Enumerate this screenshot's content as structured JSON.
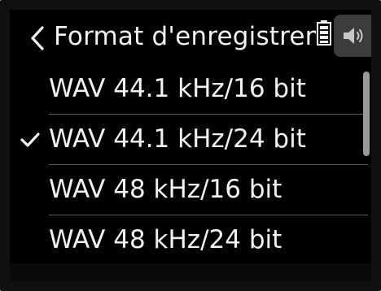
{
  "header": {
    "title": "Format d'enregistrem",
    "back_icon": "chevron-left-icon",
    "battery_icon": "battery-icon",
    "speaker_icon": "speaker-volume-icon"
  },
  "list": {
    "items": [
      {
        "label": "WAV 44.1 kHz/16 bit",
        "selected": false
      },
      {
        "label": "WAV 44.1 kHz/24 bit",
        "selected": true
      },
      {
        "label": "WAV 48 kHz/16 bit",
        "selected": false
      },
      {
        "label": "WAV 48 kHz/24 bit",
        "selected": false
      }
    ],
    "check_icon": "checkmark-icon"
  },
  "colors": {
    "background": "#000000",
    "text": "#f2f2f2",
    "divider": "#5a5a5a",
    "speaker_panel": "#3c3c3c",
    "scrollbar": "#9a9a9a"
  }
}
